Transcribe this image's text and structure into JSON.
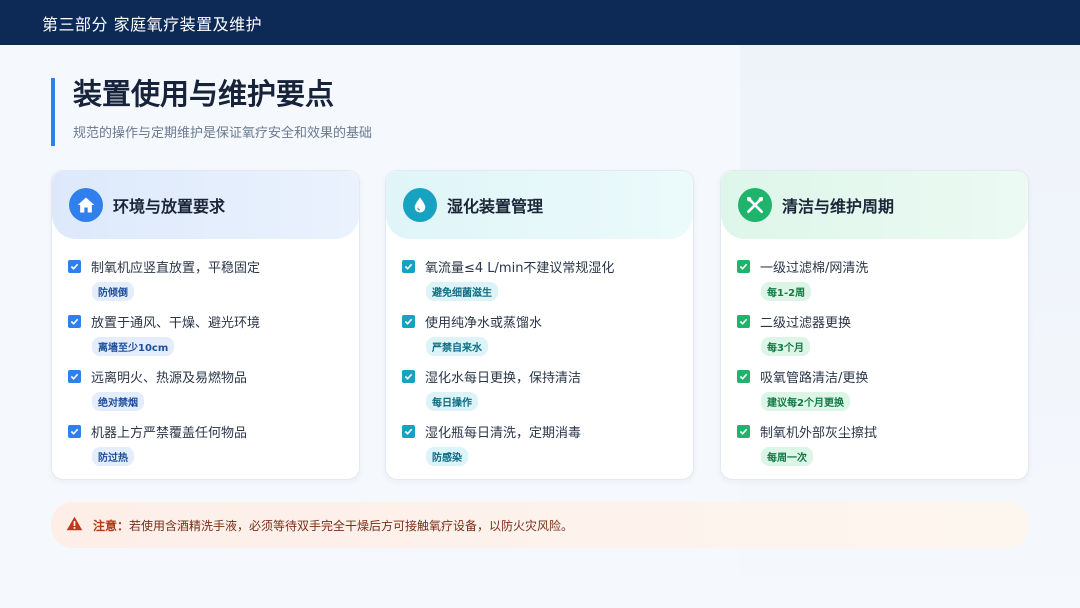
{
  "header": {
    "section_title": "第三部分 家庭氧疗装置及维护"
  },
  "page": {
    "title": "装置使用与维护要点",
    "subtitle": "规范的操作与定期维护是保证氧疗安全和效果的基础"
  },
  "cards": [
    {
      "title": "环境与放置要求",
      "icon": "home-icon",
      "accent": "#2f80ed",
      "items": [
        {
          "text": "制氧机应竖直放置，平稳固定",
          "tag": "防倾倒"
        },
        {
          "text": "放置于通风、干燥、避光环境",
          "tag": "离墙至少10cm"
        },
        {
          "text": "远离明火、热源及易燃物品",
          "tag": "绝对禁烟"
        },
        {
          "text": "机器上方严禁覆盖任何物品",
          "tag": "防过热"
        }
      ]
    },
    {
      "title": "湿化装置管理",
      "icon": "water-drop-icon",
      "accent": "#17a2c2",
      "items": [
        {
          "text": "氧流量≤4 L/min不建议常规湿化",
          "tag": "避免细菌滋生"
        },
        {
          "text": "使用纯净水或蒸馏水",
          "tag": "严禁自来水"
        },
        {
          "text": "湿化水每日更换，保持清洁",
          "tag": "每日操作"
        },
        {
          "text": "湿化瓶每日清洗，定期消毒",
          "tag": "防感染"
        }
      ]
    },
    {
      "title": "清洁与维护周期",
      "icon": "tools-icon",
      "accent": "#1fb36b",
      "items": [
        {
          "text": "一级过滤棉/网清洗",
          "tag": "每1-2周"
        },
        {
          "text": "二级过滤器更换",
          "tag": "每3个月"
        },
        {
          "text": "吸氧管路清洁/更换",
          "tag": "建议每2个月更换"
        },
        {
          "text": "制氧机外部灰尘擦拭",
          "tag": "每周一次"
        }
      ]
    }
  ],
  "notice": {
    "label": "注意：",
    "text": "若使用含酒精洗手液，必须等待双手完全干燥后方可接触氧疗设备，以防火灾风险。",
    "icon": "warning-icon"
  }
}
